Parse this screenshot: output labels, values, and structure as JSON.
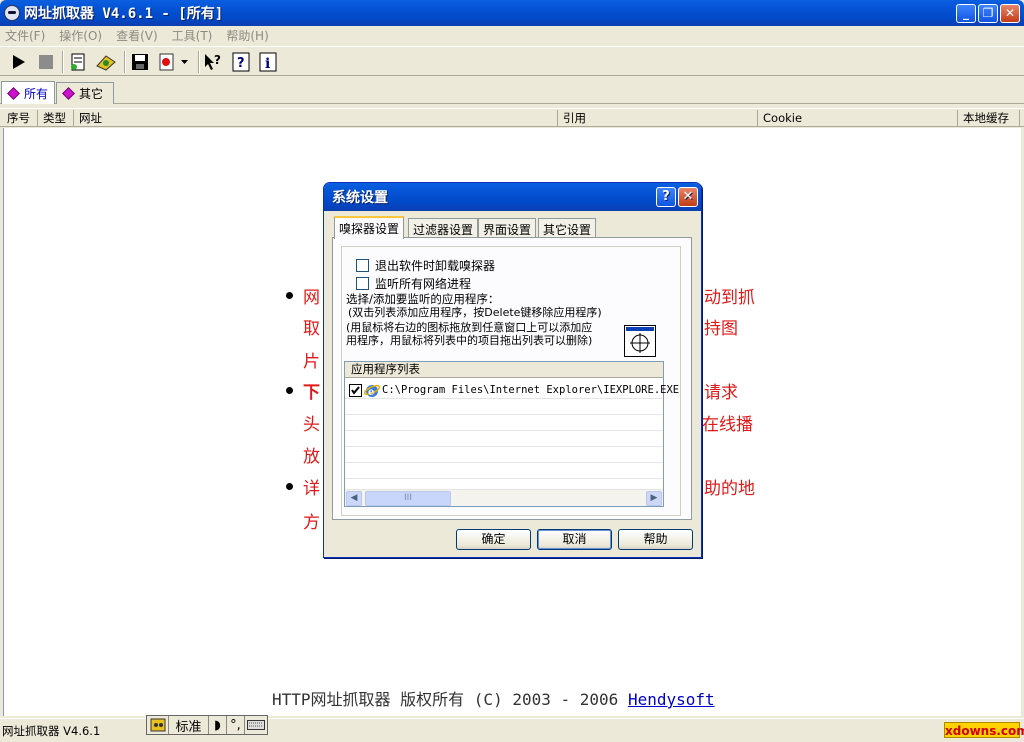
{
  "window": {
    "title": "网址抓取器 V4.6.1 - [所有]",
    "minimize": "_",
    "restore": "❐",
    "close": "✕"
  },
  "menu": [
    "文件(F)",
    "操作(O)",
    "查看(V)",
    "工具(T)",
    "帮助(H)"
  ],
  "tabs": [
    "所有",
    "其它"
  ],
  "columns": [
    "序号",
    "类型",
    "网址",
    "引用",
    "Cookie",
    "本地缓存"
  ],
  "background_text": {
    "line1a": "网",
    "line1b": "动到抓",
    "line2a": "取",
    "line2b": "持图",
    "line3a": "片",
    "line4a": "下",
    "line4b": "请求",
    "line5a": "头",
    "line5b": "在线播",
    "line6a": "放",
    "line7a": "详",
    "line7b": "助的地",
    "line8a": "方"
  },
  "copyright": {
    "text": "HTTP网址抓取器 版权所有 (C) 2003 - 2006 ",
    "link": "Hendysoft"
  },
  "status": {
    "app_name": "网址抓取器 V4.6.1",
    "ime_mode": "标准",
    "watermark": "xdowns.com"
  },
  "dialog": {
    "title": "系统设置",
    "help": "?",
    "close": "✕",
    "tabs": [
      "嗅探器设置",
      "过滤器设置",
      "界面设置",
      "其它设置"
    ],
    "checkbox1": {
      "label": "退出软件时卸载嗅探器",
      "checked": false
    },
    "checkbox2": {
      "label": "监听所有网络进程",
      "checked": false
    },
    "desc1": "选择/添加要监听的应用程序：",
    "desc2": "(双击列表添加应用程序，按Delete键移除应用程序)",
    "desc3": "(用鼠标将右边的图标拖放到任意窗口上可以添加应",
    "desc4": "用程序，用鼠标将列表中的项目拖出列表可以删除)",
    "list_header": "应用程序列表",
    "list_items": [
      {
        "path": "C:\\Program Files\\Internet Explorer\\IEXPLORE.EXE",
        "checked": true
      }
    ],
    "scroll_grip": "III",
    "buttons": {
      "ok": "确定",
      "cancel": "取消",
      "help": "帮助"
    }
  }
}
